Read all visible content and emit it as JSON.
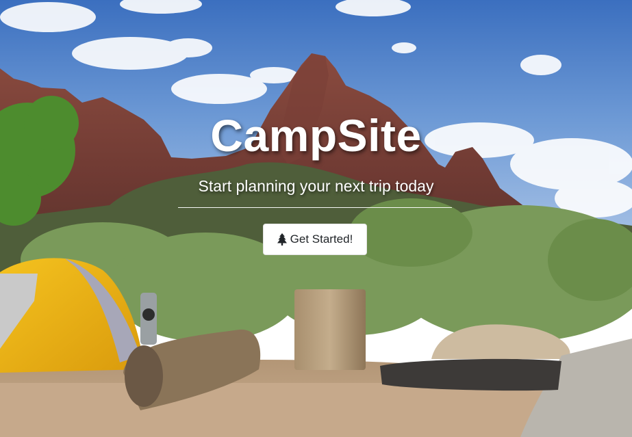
{
  "app": {
    "title": "CampSite"
  },
  "hero": {
    "title": "CampSite",
    "subtitle": "Start planning your next trip today",
    "cta_label": "Get Started!",
    "cta_icon": "tree-icon",
    "background": "mountain-campsite-photo"
  },
  "colors": {
    "text": "#ffffff",
    "button_bg": "#ffffff",
    "button_text": "#212529"
  }
}
